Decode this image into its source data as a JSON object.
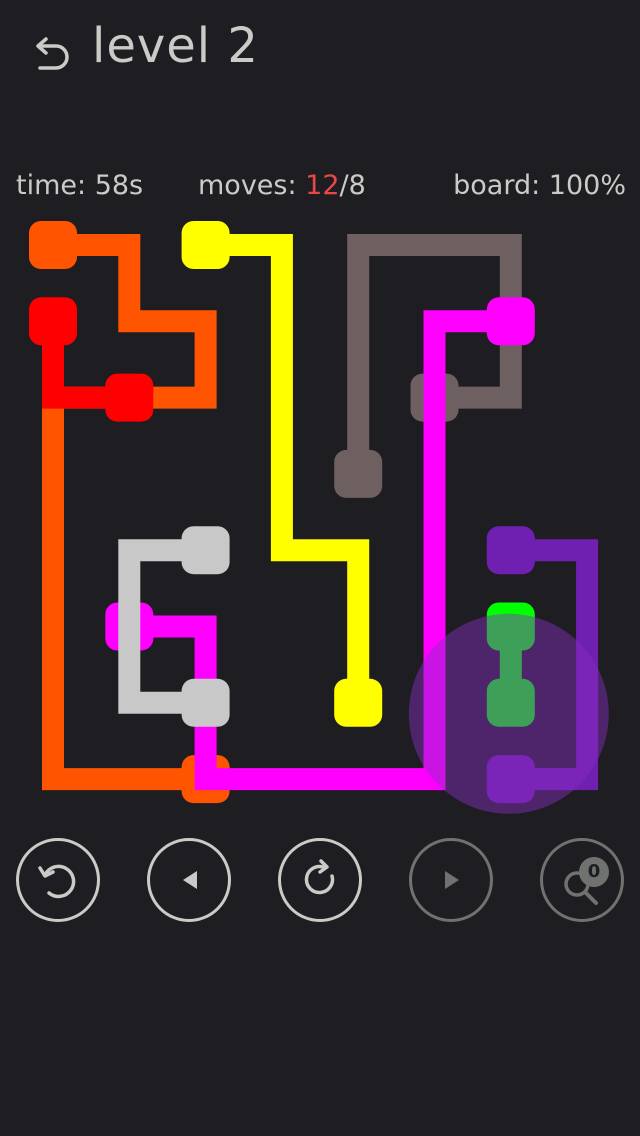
{
  "header": {
    "title": "level 2",
    "back_icon": "back-arrow-icon"
  },
  "stats": {
    "time_label": "time: ",
    "time_value": "58s",
    "moves_label": "moves: ",
    "moves_current": "12",
    "moves_separator": "/",
    "moves_target": "8",
    "board_label": "board: ",
    "board_value": "100%"
  },
  "board": {
    "rows": 7,
    "cols": 7,
    "progress": 1.0,
    "flows": [
      {
        "name": "orange",
        "color": "#ff5500",
        "path": [
          [
            0,
            0
          ],
          [
            0,
            1
          ],
          [
            1,
            1
          ],
          [
            1,
            2
          ],
          [
            2,
            2
          ],
          [
            2,
            0
          ],
          [
            3,
            0
          ],
          [
            4,
            0
          ],
          [
            5,
            0
          ],
          [
            6,
            0
          ],
          [
            7,
            0
          ],
          [
            7,
            2
          ]
        ]
      },
      {
        "name": "red",
        "color": "#ff0000",
        "path": [
          [
            1,
            0
          ],
          [
            2,
            0
          ],
          [
            2,
            1
          ]
        ]
      },
      {
        "name": "yellow",
        "color": "#ffff00",
        "path": [
          [
            0,
            2
          ],
          [
            0,
            3
          ],
          [
            1,
            3
          ],
          [
            2,
            3
          ],
          [
            3,
            3
          ],
          [
            4,
            3
          ],
          [
            4,
            4
          ],
          [
            5,
            4
          ],
          [
            6,
            4
          ]
        ]
      },
      {
        "name": "brown",
        "color": "#6e6060",
        "path": [
          [
            3,
            4
          ],
          [
            2,
            4
          ],
          [
            1,
            4
          ],
          [
            0,
            4
          ],
          [
            0,
            5
          ],
          [
            0,
            6
          ],
          [
            1,
            6
          ],
          [
            2,
            6
          ],
          [
            2,
            5
          ]
        ]
      },
      {
        "name": "magenta",
        "color": "#ff00ff",
        "path": [
          [
            1,
            6
          ],
          [
            1,
            5
          ],
          [
            2,
            5
          ],
          [
            3,
            5
          ],
          [
            4,
            5
          ],
          [
            5,
            5
          ],
          [
            6,
            5
          ],
          [
            7,
            5
          ],
          [
            7,
            4
          ],
          [
            7,
            3
          ],
          [
            7,
            2
          ],
          [
            6,
            2
          ],
          [
            5,
            2
          ],
          [
            5,
            1
          ]
        ]
      },
      {
        "name": "grey",
        "color": "#c8c8c8",
        "path": [
          [
            4,
            2
          ],
          [
            4,
            1
          ],
          [
            5,
            1
          ],
          [
            6,
            1
          ],
          [
            6,
            2
          ]
        ]
      },
      {
        "name": "purple",
        "color": "#7020b0",
        "path": [
          [
            4,
            6
          ],
          [
            4,
            7
          ],
          [
            5,
            7
          ],
          [
            6,
            7
          ],
          [
            7,
            7
          ],
          [
            7,
            6
          ]
        ]
      },
      {
        "name": "green",
        "color": "#00ff00",
        "path": [
          [
            5,
            6
          ],
          [
            6,
            6
          ]
        ]
      }
    ]
  },
  "touch_indicator": {
    "color": "#8a2cc4",
    "opacity": 0.45
  },
  "controls": [
    {
      "name": "undo-button",
      "icon": "undo-icon",
      "enabled": true
    },
    {
      "name": "previous-level-button",
      "icon": "triangle-left-icon",
      "enabled": true
    },
    {
      "name": "restart-button",
      "icon": "restart-icon",
      "enabled": true
    },
    {
      "name": "next-level-button",
      "icon": "triangle-right-icon",
      "enabled": false
    },
    {
      "name": "hint-button",
      "icon": "magnifier-icon",
      "enabled": false,
      "badge": "0"
    }
  ],
  "colors": {
    "background": "#1e1e22",
    "text": "#c9ccc6",
    "accent_red": "#e84848",
    "disabled": "#6f726e"
  }
}
